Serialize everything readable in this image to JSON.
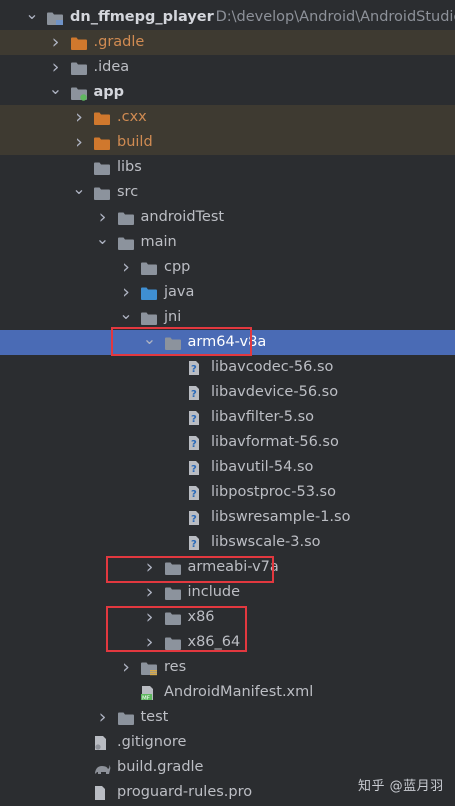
{
  "project": {
    "name": "dn_ffmepg_player",
    "path": "D:\\develop\\Android\\AndroidStudio"
  },
  "tree": [
    {
      "label": "dn_ffmepg_player",
      "icon": "module-folder-icon",
      "arrow": "down",
      "depth": 0,
      "style": "bold",
      "path": "D:\\develop\\Android\\AndroidStudio"
    },
    {
      "label": ".gradle",
      "icon": "excluded-folder-icon",
      "arrow": "right",
      "depth": 1,
      "style": "orange",
      "bg": "excluded"
    },
    {
      "label": ".idea",
      "icon": "folder-icon",
      "arrow": "right",
      "depth": 1
    },
    {
      "label": "app",
      "icon": "android-module-folder-icon",
      "arrow": "down",
      "depth": 1,
      "style": "bold"
    },
    {
      "label": ".cxx",
      "icon": "excluded-folder-icon",
      "arrow": "right",
      "depth": 2,
      "style": "orange",
      "bg": "excluded"
    },
    {
      "label": "build",
      "icon": "excluded-folder-icon",
      "arrow": "right",
      "depth": 2,
      "style": "orange",
      "bg": "excluded"
    },
    {
      "label": "libs",
      "icon": "folder-icon",
      "arrow": "none",
      "depth": 2
    },
    {
      "label": "src",
      "icon": "folder-icon",
      "arrow": "down",
      "depth": 2
    },
    {
      "label": "androidTest",
      "icon": "folder-icon",
      "arrow": "right",
      "depth": 3
    },
    {
      "label": "main",
      "icon": "folder-icon",
      "arrow": "down",
      "depth": 3
    },
    {
      "label": "cpp",
      "icon": "folder-icon",
      "arrow": "right",
      "depth": 4
    },
    {
      "label": "java",
      "icon": "source-folder-icon",
      "arrow": "right",
      "depth": 4
    },
    {
      "label": "jni",
      "icon": "folder-icon",
      "arrow": "down",
      "depth": 4
    },
    {
      "label": "arm64-v8a",
      "icon": "folder-icon",
      "arrow": "down",
      "depth": 5,
      "bg": "selected"
    },
    {
      "label": "libavcodec-56.so",
      "icon": "unknown-file-icon",
      "arrow": "none",
      "depth": 6
    },
    {
      "label": "libavdevice-56.so",
      "icon": "unknown-file-icon",
      "arrow": "none",
      "depth": 6
    },
    {
      "label": "libavfilter-5.so",
      "icon": "unknown-file-icon",
      "arrow": "none",
      "depth": 6
    },
    {
      "label": "libavformat-56.so",
      "icon": "unknown-file-icon",
      "arrow": "none",
      "depth": 6
    },
    {
      "label": "libavutil-54.so",
      "icon": "unknown-file-icon",
      "arrow": "none",
      "depth": 6
    },
    {
      "label": "libpostproc-53.so",
      "icon": "unknown-file-icon",
      "arrow": "none",
      "depth": 6
    },
    {
      "label": "libswresample-1.so",
      "icon": "unknown-file-icon",
      "arrow": "none",
      "depth": 6
    },
    {
      "label": "libswscale-3.so",
      "icon": "unknown-file-icon",
      "arrow": "none",
      "depth": 6
    },
    {
      "label": "armeabi-v7a",
      "icon": "folder-icon",
      "arrow": "right",
      "depth": 5
    },
    {
      "label": "include",
      "icon": "folder-icon",
      "arrow": "right",
      "depth": 5
    },
    {
      "label": "x86",
      "icon": "folder-icon",
      "arrow": "right",
      "depth": 5
    },
    {
      "label": "x86_64",
      "icon": "folder-icon",
      "arrow": "right",
      "depth": 5
    },
    {
      "label": "res",
      "icon": "resource-folder-icon",
      "arrow": "right",
      "depth": 4
    },
    {
      "label": "AndroidManifest.xml",
      "icon": "manifest-file-icon",
      "arrow": "none",
      "depth": 4
    },
    {
      "label": "test",
      "icon": "folder-icon",
      "arrow": "right",
      "depth": 3
    },
    {
      "label": ".gitignore",
      "icon": "gitignore-file-icon",
      "arrow": "none",
      "depth": 2
    },
    {
      "label": "build.gradle",
      "icon": "gradle-file-icon",
      "arrow": "none",
      "depth": 2
    },
    {
      "label": "proguard-rules.pro",
      "icon": "pro-file-icon",
      "arrow": "none",
      "depth": 2
    }
  ],
  "watermark": "知乎 @蓝月羽",
  "colors": {
    "background": "#2b2d30",
    "selection": "#4a6bb5",
    "excluded_bg": "#3e3a31",
    "excluded_text": "#d08b52",
    "highlight_box": "#e2383f"
  }
}
